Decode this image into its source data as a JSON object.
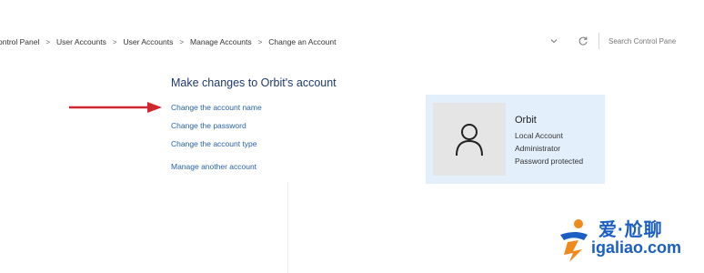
{
  "breadcrumb": {
    "items": [
      "ontrol Panel",
      "User Accounts",
      "User Accounts",
      "Manage Accounts",
      "Change an Account"
    ],
    "separator": ">"
  },
  "toolbar": {
    "dropdown_icon": "chevron-down-icon",
    "refresh_icon": "refresh-icon",
    "search_placeholder": "Search Control Pane"
  },
  "main": {
    "heading": "Make changes to Orbit's account",
    "links": {
      "change_name": "Change the account name",
      "change_password": "Change the password",
      "change_type": "Change the account type",
      "manage_another": "Manage another account"
    }
  },
  "account": {
    "name": "Orbit",
    "type": "Local Account",
    "role": "Administrator",
    "status": "Password protected"
  },
  "watermark": {
    "chinese": "爱·尬聊",
    "url": "igaliao.com"
  },
  "colors": {
    "link": "#2a62a8",
    "heading": "#1e3a6e",
    "card_bg": "#e3effb",
    "arrow": "#d0262d",
    "watermark_blue": "#1b5fc4",
    "watermark_orange": "#f08a1c"
  }
}
